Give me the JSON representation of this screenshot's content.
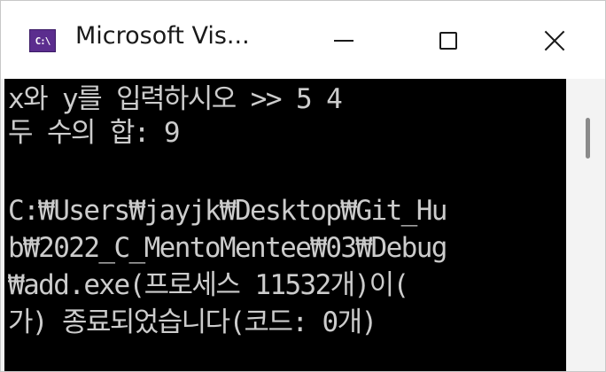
{
  "window": {
    "title": "Microsoft Vis...",
    "icon_text": "C:\\",
    "icon": "console-app-icon",
    "controls": {
      "minimize": "minimize-icon",
      "maximize": "maximize-icon",
      "close": "close-icon"
    }
  },
  "console": {
    "lines": [
      "x와 y를 입력하시오 >> 5 4",
      "두 수의 합: 9",
      "",
      "C:₩Users₩jayjk₩Desktop₩Git_Hu",
      "b₩2022_C_MentoMentee₩03₩Debug",
      "₩add.exe(프로세스 11532개)이(",
      "가) 종료되었습니다(코드: 0개)"
    ]
  },
  "colors": {
    "console_background": "#000000",
    "console_text": "#cccccc",
    "titlebar": "#ffffff",
    "icon_background": "#5b2d8e"
  }
}
